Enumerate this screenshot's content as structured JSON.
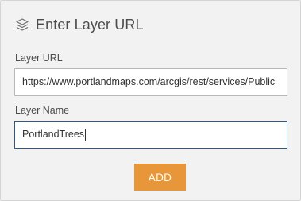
{
  "header": {
    "title": "Enter Layer URL",
    "icon": "layers-icon"
  },
  "url_field": {
    "label": "Layer URL",
    "value": "https://www.portlandmaps.com/arcgis/rest/services/Public"
  },
  "name_field": {
    "label": "Layer Name",
    "value": "PortlandTrees"
  },
  "add_button": {
    "label": "ADD"
  },
  "colors": {
    "panel_background": "#f2f2f2",
    "accent_button": "#e8963a",
    "focused_border": "#2a5a8a"
  }
}
